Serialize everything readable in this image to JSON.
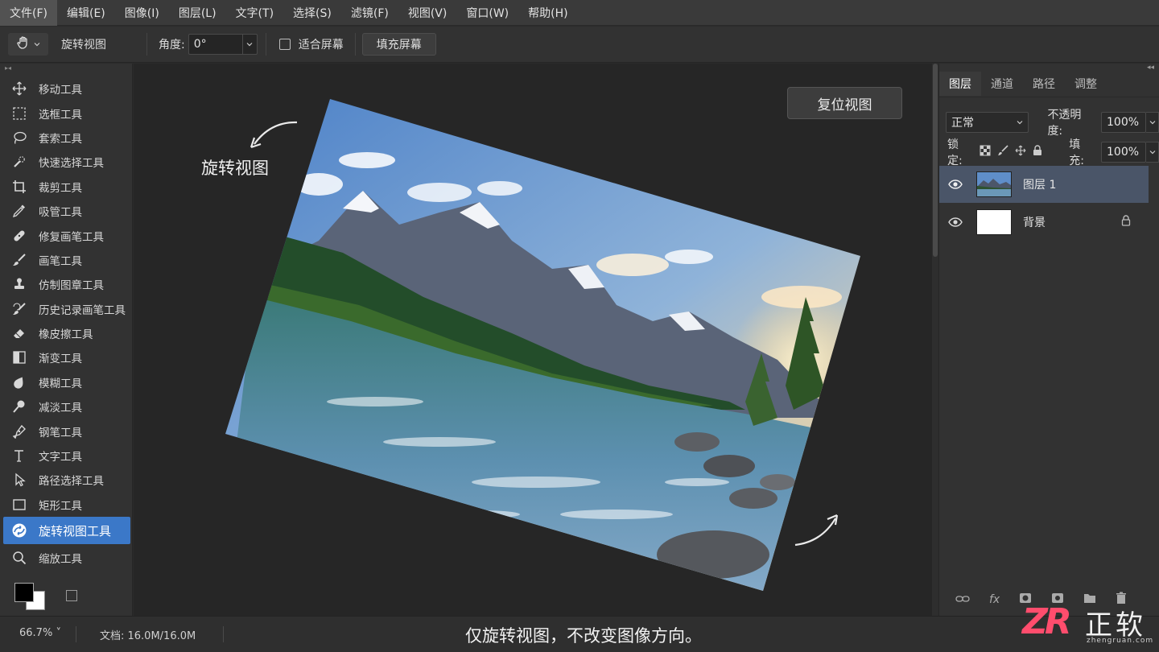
{
  "menubar": {
    "items": [
      "文件(F)",
      "编辑(E)",
      "图像(I)",
      "图层(L)",
      "文字(T)",
      "选择(S)",
      "滤镜(F)",
      "视图(V)",
      "窗口(W)",
      "帮助(H)"
    ]
  },
  "options": {
    "tool_name": "旋转视图",
    "angle_label": "角度:",
    "angle_value": "0°",
    "fit_screen_label": "适合屏幕",
    "fit_screen_checked": false,
    "fill_screen_label": "填充屏幕"
  },
  "tools": [
    {
      "label": "移动工具",
      "icon": "move-icon"
    },
    {
      "label": "选框工具",
      "icon": "marquee-icon"
    },
    {
      "label": "套索工具",
      "icon": "lasso-icon"
    },
    {
      "label": "快速选择工具",
      "icon": "quick-select-icon"
    },
    {
      "label": "裁剪工具",
      "icon": "crop-icon"
    },
    {
      "label": "吸管工具",
      "icon": "eyedropper-icon"
    },
    {
      "label": "修复画笔工具",
      "icon": "healing-brush-icon"
    },
    {
      "label": "画笔工具",
      "icon": "brush-icon"
    },
    {
      "label": "仿制图章工具",
      "icon": "clone-stamp-icon"
    },
    {
      "label": "历史记录画笔工具",
      "icon": "history-brush-icon"
    },
    {
      "label": "橡皮擦工具",
      "icon": "eraser-icon"
    },
    {
      "label": "渐变工具",
      "icon": "gradient-icon"
    },
    {
      "label": "模糊工具",
      "icon": "blur-icon"
    },
    {
      "label": "减淡工具",
      "icon": "dodge-icon"
    },
    {
      "label": "钢笔工具",
      "icon": "pen-icon"
    },
    {
      "label": "文字工具",
      "icon": "type-icon"
    },
    {
      "label": "路径选择工具",
      "icon": "path-select-icon"
    },
    {
      "label": "矩形工具",
      "icon": "rectangle-icon"
    },
    {
      "label": "旋转视图工具",
      "icon": "rotate-view-icon",
      "active": true
    },
    {
      "label": "缩放工具",
      "icon": "zoom-icon"
    }
  ],
  "canvas": {
    "rotate_label": "旋转视图",
    "reset_button": "复位视图"
  },
  "layers_panel": {
    "tabs": [
      "图层",
      "通道",
      "路径",
      "调整"
    ],
    "active_tab": "图层",
    "blend_mode": "正常",
    "opacity_label": "不透明度:",
    "opacity_value": "100%",
    "lock_label": "锁定:",
    "fill_label": "填充:",
    "fill_value": "100%",
    "layers": [
      {
        "name": "图层 1",
        "selected": true,
        "visible": true
      },
      {
        "name": "背景",
        "selected": false,
        "visible": true,
        "locked": true
      }
    ]
  },
  "status": {
    "zoom": "66.7%",
    "doc_info": "文档: 16.0M/16.0M",
    "caption": "仅旋转视图，不改变图像方向。"
  },
  "watermark": {
    "logo": "ZR",
    "name": "正软",
    "url": "zhengruan.com"
  },
  "colors": {
    "accent": "#3b78c8",
    "selected_layer": "#4a5568",
    "watermark_pink": "#ff4d6d"
  }
}
